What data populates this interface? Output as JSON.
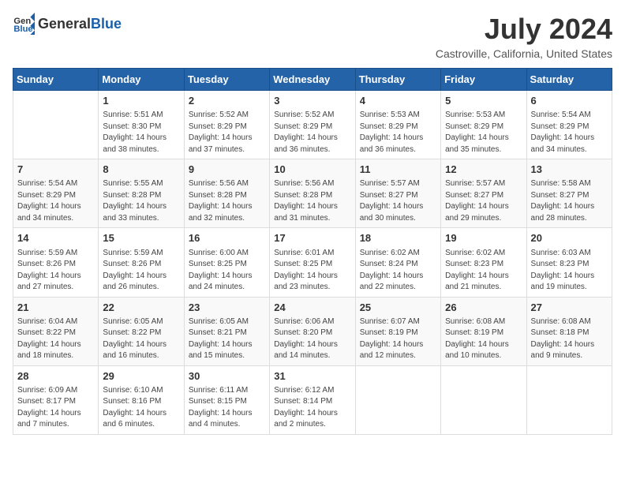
{
  "logo": {
    "general": "General",
    "blue": "Blue"
  },
  "title": {
    "month_year": "July 2024",
    "location": "Castroville, California, United States"
  },
  "weekdays": [
    "Sunday",
    "Monday",
    "Tuesday",
    "Wednesday",
    "Thursday",
    "Friday",
    "Saturday"
  ],
  "weeks": [
    [
      {
        "day": "",
        "content": ""
      },
      {
        "day": "1",
        "content": "Sunrise: 5:51 AM\nSunset: 8:30 PM\nDaylight: 14 hours\nand 38 minutes."
      },
      {
        "day": "2",
        "content": "Sunrise: 5:52 AM\nSunset: 8:29 PM\nDaylight: 14 hours\nand 37 minutes."
      },
      {
        "day": "3",
        "content": "Sunrise: 5:52 AM\nSunset: 8:29 PM\nDaylight: 14 hours\nand 36 minutes."
      },
      {
        "day": "4",
        "content": "Sunrise: 5:53 AM\nSunset: 8:29 PM\nDaylight: 14 hours\nand 36 minutes."
      },
      {
        "day": "5",
        "content": "Sunrise: 5:53 AM\nSunset: 8:29 PM\nDaylight: 14 hours\nand 35 minutes."
      },
      {
        "day": "6",
        "content": "Sunrise: 5:54 AM\nSunset: 8:29 PM\nDaylight: 14 hours\nand 34 minutes."
      }
    ],
    [
      {
        "day": "7",
        "content": "Sunrise: 5:54 AM\nSunset: 8:29 PM\nDaylight: 14 hours\nand 34 minutes."
      },
      {
        "day": "8",
        "content": "Sunrise: 5:55 AM\nSunset: 8:28 PM\nDaylight: 14 hours\nand 33 minutes."
      },
      {
        "day": "9",
        "content": "Sunrise: 5:56 AM\nSunset: 8:28 PM\nDaylight: 14 hours\nand 32 minutes."
      },
      {
        "day": "10",
        "content": "Sunrise: 5:56 AM\nSunset: 8:28 PM\nDaylight: 14 hours\nand 31 minutes."
      },
      {
        "day": "11",
        "content": "Sunrise: 5:57 AM\nSunset: 8:27 PM\nDaylight: 14 hours\nand 30 minutes."
      },
      {
        "day": "12",
        "content": "Sunrise: 5:57 AM\nSunset: 8:27 PM\nDaylight: 14 hours\nand 29 minutes."
      },
      {
        "day": "13",
        "content": "Sunrise: 5:58 AM\nSunset: 8:27 PM\nDaylight: 14 hours\nand 28 minutes."
      }
    ],
    [
      {
        "day": "14",
        "content": "Sunrise: 5:59 AM\nSunset: 8:26 PM\nDaylight: 14 hours\nand 27 minutes."
      },
      {
        "day": "15",
        "content": "Sunrise: 5:59 AM\nSunset: 8:26 PM\nDaylight: 14 hours\nand 26 minutes."
      },
      {
        "day": "16",
        "content": "Sunrise: 6:00 AM\nSunset: 8:25 PM\nDaylight: 14 hours\nand 24 minutes."
      },
      {
        "day": "17",
        "content": "Sunrise: 6:01 AM\nSunset: 8:25 PM\nDaylight: 14 hours\nand 23 minutes."
      },
      {
        "day": "18",
        "content": "Sunrise: 6:02 AM\nSunset: 8:24 PM\nDaylight: 14 hours\nand 22 minutes."
      },
      {
        "day": "19",
        "content": "Sunrise: 6:02 AM\nSunset: 8:23 PM\nDaylight: 14 hours\nand 21 minutes."
      },
      {
        "day": "20",
        "content": "Sunrise: 6:03 AM\nSunset: 8:23 PM\nDaylight: 14 hours\nand 19 minutes."
      }
    ],
    [
      {
        "day": "21",
        "content": "Sunrise: 6:04 AM\nSunset: 8:22 PM\nDaylight: 14 hours\nand 18 minutes."
      },
      {
        "day": "22",
        "content": "Sunrise: 6:05 AM\nSunset: 8:22 PM\nDaylight: 14 hours\nand 16 minutes."
      },
      {
        "day": "23",
        "content": "Sunrise: 6:05 AM\nSunset: 8:21 PM\nDaylight: 14 hours\nand 15 minutes."
      },
      {
        "day": "24",
        "content": "Sunrise: 6:06 AM\nSunset: 8:20 PM\nDaylight: 14 hours\nand 14 minutes."
      },
      {
        "day": "25",
        "content": "Sunrise: 6:07 AM\nSunset: 8:19 PM\nDaylight: 14 hours\nand 12 minutes."
      },
      {
        "day": "26",
        "content": "Sunrise: 6:08 AM\nSunset: 8:19 PM\nDaylight: 14 hours\nand 10 minutes."
      },
      {
        "day": "27",
        "content": "Sunrise: 6:08 AM\nSunset: 8:18 PM\nDaylight: 14 hours\nand 9 minutes."
      }
    ],
    [
      {
        "day": "28",
        "content": "Sunrise: 6:09 AM\nSunset: 8:17 PM\nDaylight: 14 hours\nand 7 minutes."
      },
      {
        "day": "29",
        "content": "Sunrise: 6:10 AM\nSunset: 8:16 PM\nDaylight: 14 hours\nand 6 minutes."
      },
      {
        "day": "30",
        "content": "Sunrise: 6:11 AM\nSunset: 8:15 PM\nDaylight: 14 hours\nand 4 minutes."
      },
      {
        "day": "31",
        "content": "Sunrise: 6:12 AM\nSunset: 8:14 PM\nDaylight: 14 hours\nand 2 minutes."
      },
      {
        "day": "",
        "content": ""
      },
      {
        "day": "",
        "content": ""
      },
      {
        "day": "",
        "content": ""
      }
    ]
  ]
}
